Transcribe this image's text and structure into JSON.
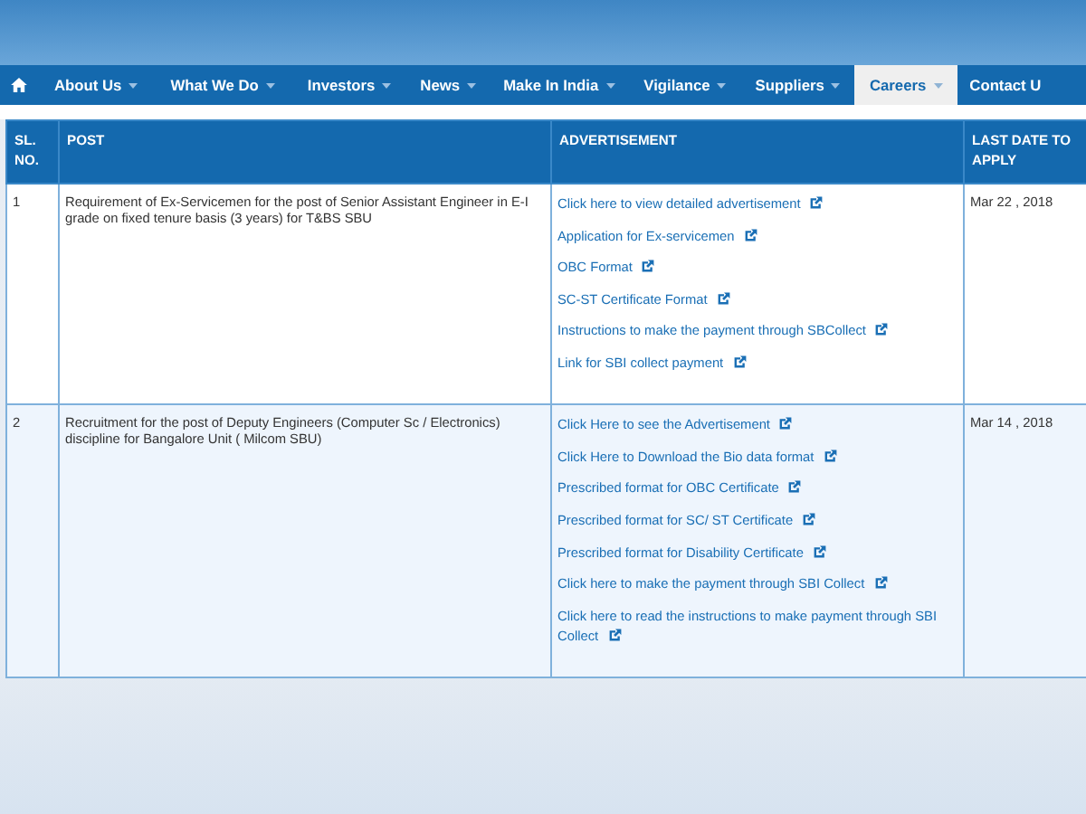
{
  "nav": [
    {
      "label": "About Us",
      "selected": false,
      "dropdown": true
    },
    {
      "label": "What We Do",
      "selected": false,
      "dropdown": true
    },
    {
      "label": "Investors",
      "selected": false,
      "dropdown": true
    },
    {
      "label": "News",
      "selected": false,
      "dropdown": true
    },
    {
      "label": "Make In India",
      "selected": false,
      "dropdown": true
    },
    {
      "label": "Vigilance",
      "selected": false,
      "dropdown": true
    },
    {
      "label": "Suppliers",
      "selected": false,
      "dropdown": true
    },
    {
      "label": "Careers",
      "selected": true,
      "dropdown": true
    },
    {
      "label": "Contact U",
      "selected": false,
      "dropdown": false
    }
  ],
  "table": {
    "columns": [
      "SL. NO.",
      "POST",
      "ADVERTISEMENT",
      "LAST DATE TO APPLY"
    ],
    "rows": [
      {
        "sl": "1",
        "post": "Requirement of Ex-Servicemen for the post of Senior Assistant Engineer in E-I grade on fixed tenure basis (3 years) for T&BS SBU",
        "links": [
          "Click here to view detailed advertisement",
          "Application for Ex-servicemen",
          "OBC Format",
          "SC-ST Certificate Format",
          "Instructions to make the payment through SBCollect",
          "Link for SBI collect payment"
        ],
        "date": "Mar 22 , 2018"
      },
      {
        "sl": "2",
        "post": "Recruitment for the post of Deputy Engineers (Computer Sc / Electronics) discipline for Bangalore Unit ( Milcom SBU)",
        "links": [
          "Click Here to see the Advertisement",
          "Click Here to Download the Bio data format",
          "Prescribed format for OBC Certificate",
          "Prescribed format for SC/ ST Certificate",
          "Prescribed format for Disability Certificate",
          "Click here to make the payment through SBI Collect",
          "Click here to read the instructions to make payment through SBI Collect"
        ],
        "date": "Mar 14 , 2018"
      }
    ]
  }
}
